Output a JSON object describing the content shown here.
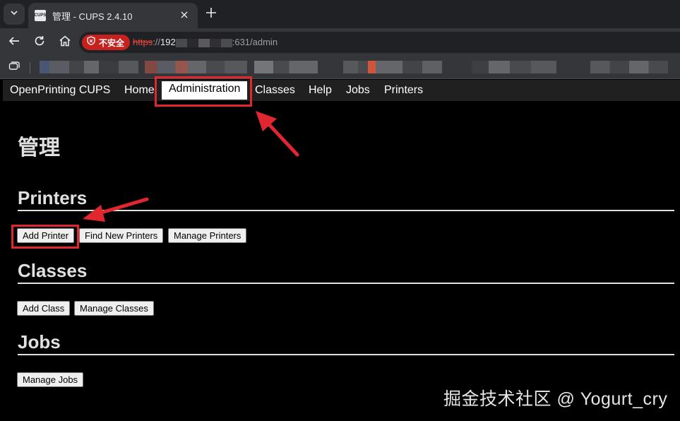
{
  "browser": {
    "tab_title": "管理 - CUPS 2.4.10",
    "favicon_text": "CUPS",
    "security_label": "不安全",
    "url_scheme": "https",
    "url_sep": "://",
    "url_host_start": "192",
    "url_host_end": ":631/admin",
    "icons": {
      "tab_search": "chevron-down-icon",
      "close": "close-icon",
      "new_tab": "plus-icon",
      "back": "back-arrow-icon",
      "reload": "reload-icon",
      "home": "home-icon",
      "security": "shield-warning-icon"
    }
  },
  "cups_nav": {
    "brand": "OpenPrinting CUPS",
    "home": "Home",
    "administration": "Administration",
    "classes": "Classes",
    "help": "Help",
    "jobs": "Jobs",
    "printers": "Printers"
  },
  "page": {
    "title": "管理",
    "printers": {
      "heading": "Printers",
      "add": "Add Printer",
      "find": "Find New Printers",
      "manage": "Manage Printers"
    },
    "classes": {
      "heading": "Classes",
      "add": "Add Class",
      "manage": "Manage Classes"
    },
    "jobs": {
      "heading": "Jobs",
      "manage": "Manage Jobs"
    }
  },
  "watermark": "掘金技术社区 @ Yogurt_cry",
  "colors": {
    "highlight": "#e0262f",
    "insecure": "#c5221f"
  }
}
